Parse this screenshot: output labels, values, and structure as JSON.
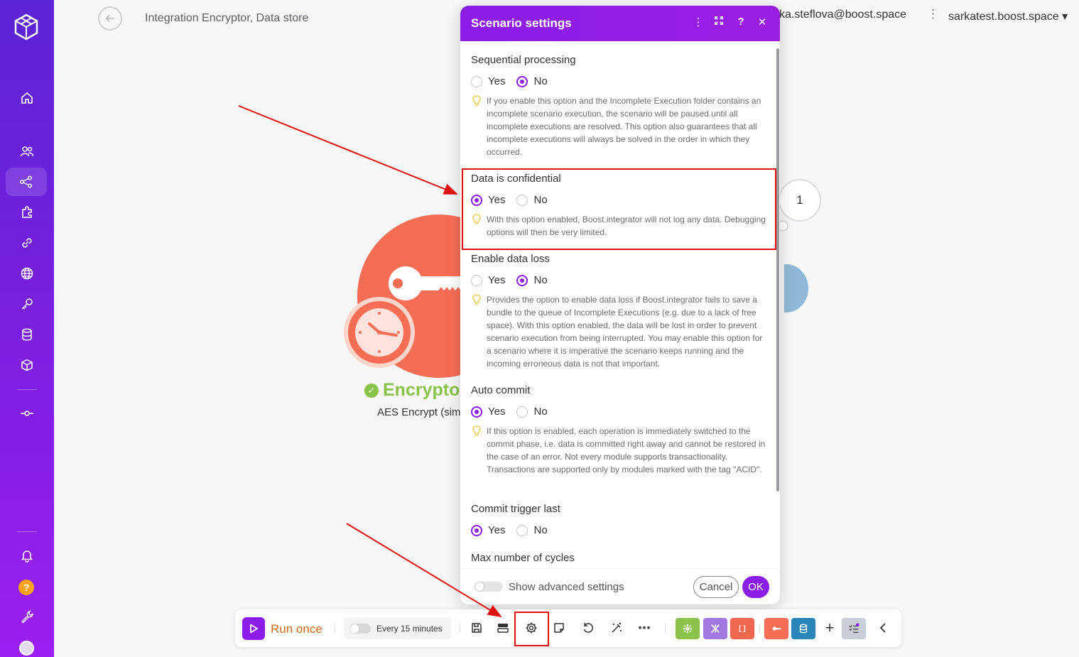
{
  "header": {
    "breadcrumb": "Integration Encryptor, Data store",
    "user_email": "ka.steflova@boost.space",
    "org": "sarkatest.boost.space ▾"
  },
  "canvas": {
    "module_name": "Encrypto",
    "module_subtitle": "AES Encrypt (simp",
    "bubble_count": "1"
  },
  "modal": {
    "title": "Scenario settings",
    "sections": [
      {
        "title": "Sequential processing",
        "yes": "Yes",
        "no": "No",
        "selected": "No",
        "hint": "If you enable this option and the Incomplete Execution folder contains an incomplete scenario execution, the scenario will be paused until all incomplete executions are resolved. This option also guarantees that all incomplete executions will always be solved in the order in which they occurred."
      },
      {
        "title": "Data is confidential",
        "yes": "Yes",
        "no": "No",
        "selected": "Yes",
        "hint": "With this option enabled, Boost.integrator will not log any data. Debugging options will then be very limited."
      },
      {
        "title": "Enable data loss",
        "yes": "Yes",
        "no": "No",
        "selected": "No",
        "hint": "Provides the option to enable data loss if Boost.integrator fails to save a bundle to the queue of Incomplete Executions (e.g. due to a lack of free space). With this option enabled, the data will be lost in order to prevent scenario execution from being interrupted. You may enable this option for a scenario where it is imperative the scenario keeps running and the incoming erroneous data is not that important."
      },
      {
        "title": "Auto commit",
        "yes": "Yes",
        "no": "No",
        "selected": "Yes",
        "hint": "If this option is enabled, each operation is immediately switched to the commit phase, i.e. data is committed right away and cannot be restored in the case of an error. Not every module supports transactionality. Transactions are supported only by modules marked with the tag \"ACID\"."
      },
      {
        "title": "Commit trigger last",
        "yes": "Yes",
        "no": "No",
        "selected": "Yes"
      },
      {
        "title": "Max number of cycles"
      }
    ],
    "footer": {
      "advanced_label": "Show advanced settings",
      "cancel_label": "Cancel",
      "ok_label": "OK"
    }
  },
  "toolbar": {
    "run_label": "Run once",
    "schedule_label": "Every 15 minutes"
  },
  "colors": {
    "accent": "#8a1de8",
    "run_label": "#d46a1a",
    "module": "#f66d56",
    "success": "#8ac34a",
    "annotation": "#e01010"
  }
}
